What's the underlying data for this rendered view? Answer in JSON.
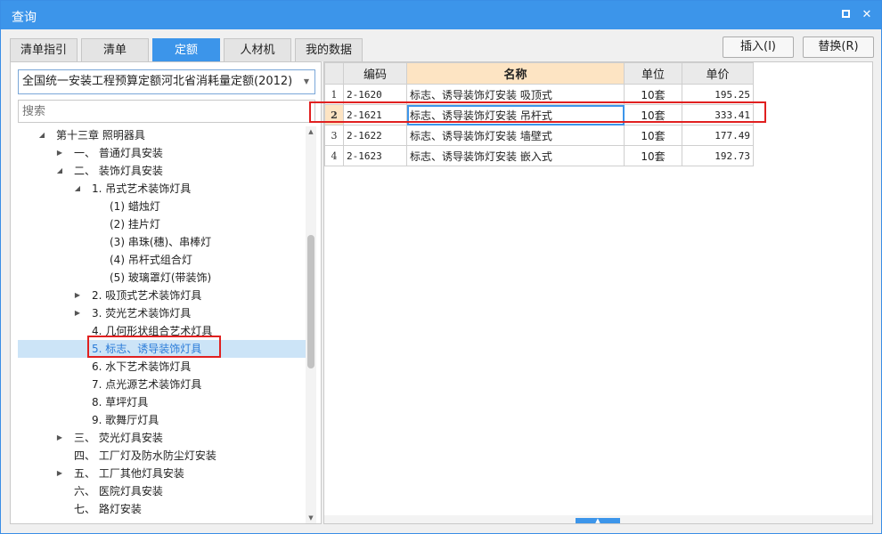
{
  "window": {
    "title": "查询",
    "maximize_icon": "maximize-icon",
    "close_icon": "close-icon",
    "close_glyph": "✕"
  },
  "tabs": [
    {
      "label": "清单指引",
      "active": false
    },
    {
      "label": "清单",
      "active": false
    },
    {
      "label": "定额",
      "active": true
    },
    {
      "label": "人材机",
      "active": false
    },
    {
      "label": "我的数据",
      "active": false
    }
  ],
  "actions": {
    "insert_label": "插入(I)",
    "replace_label": "替换(R)"
  },
  "left": {
    "quota_library": "全国统一安装工程预算定额河北省消耗量定额(2012)",
    "search_placeholder": "搜索",
    "tree": [
      {
        "label": "第十三章 照明器具",
        "toggle": "expanded"
      },
      {
        "label": "一、 普通灯具安装",
        "toggle": "collapsed"
      },
      {
        "label": "二、 装饰灯具安装",
        "toggle": "expanded"
      },
      {
        "label": "1. 吊式艺术装饰灯具",
        "toggle": "expanded"
      },
      {
        "label": "(1) 蜡烛灯",
        "toggle": "none"
      },
      {
        "label": "(2) 挂片灯",
        "toggle": "none"
      },
      {
        "label": "(3) 串珠(穗)、串棒灯",
        "toggle": "none"
      },
      {
        "label": "(4) 吊杆式组合灯",
        "toggle": "none"
      },
      {
        "label": "(5) 玻璃罩灯(带装饰)",
        "toggle": "none"
      },
      {
        "label": "2. 吸顶式艺术装饰灯具",
        "toggle": "collapsed"
      },
      {
        "label": "3. 荧光艺术装饰灯具",
        "toggle": "collapsed"
      },
      {
        "label": "4. 几何形状组合艺术灯具",
        "toggle": "none"
      },
      {
        "label": "5. 标志、诱导装饰灯具",
        "toggle": "none",
        "selected": true
      },
      {
        "label": "6. 水下艺术装饰灯具",
        "toggle": "none"
      },
      {
        "label": "7. 点光源艺术装饰灯具",
        "toggle": "none"
      },
      {
        "label": "8. 草坪灯具",
        "toggle": "none"
      },
      {
        "label": "9. 歌舞厅灯具",
        "toggle": "none"
      },
      {
        "label": "三、 荧光灯具安装",
        "toggle": "collapsed"
      },
      {
        "label": "四、 工厂灯及防水防尘灯安装",
        "toggle": "none"
      },
      {
        "label": "五、 工厂其他灯具安装",
        "toggle": "collapsed"
      },
      {
        "label": "六、 医院灯具安装",
        "toggle": "none"
      },
      {
        "label": "七、 路灯安装",
        "toggle": "none"
      }
    ]
  },
  "grid": {
    "columns": [
      "编码",
      "名称",
      "单位",
      "单价"
    ],
    "sorted_column": "名称",
    "rows": [
      {
        "no": "1",
        "code": "2-1620",
        "name": "标志、诱导装饰灯安装 吸顶式",
        "unit": "10套",
        "price": "195.25"
      },
      {
        "no": "2",
        "code": "2-1621",
        "name": "标志、诱导装饰灯安装 吊杆式",
        "unit": "10套",
        "price": "333.41",
        "current": true
      },
      {
        "no": "3",
        "code": "2-1622",
        "name": "标志、诱导装饰灯安装 墙壁式",
        "unit": "10套",
        "price": "177.49"
      },
      {
        "no": "4",
        "code": "2-1623",
        "name": "标志、诱导装饰灯安装 嵌入式",
        "unit": "10套",
        "price": "192.73"
      }
    ]
  },
  "colors": {
    "accent": "#3c95ea",
    "highlight_box": "#e02020",
    "selected_row_bg": "#fde4c3",
    "selected_tree_bg": "#cce4f7"
  }
}
